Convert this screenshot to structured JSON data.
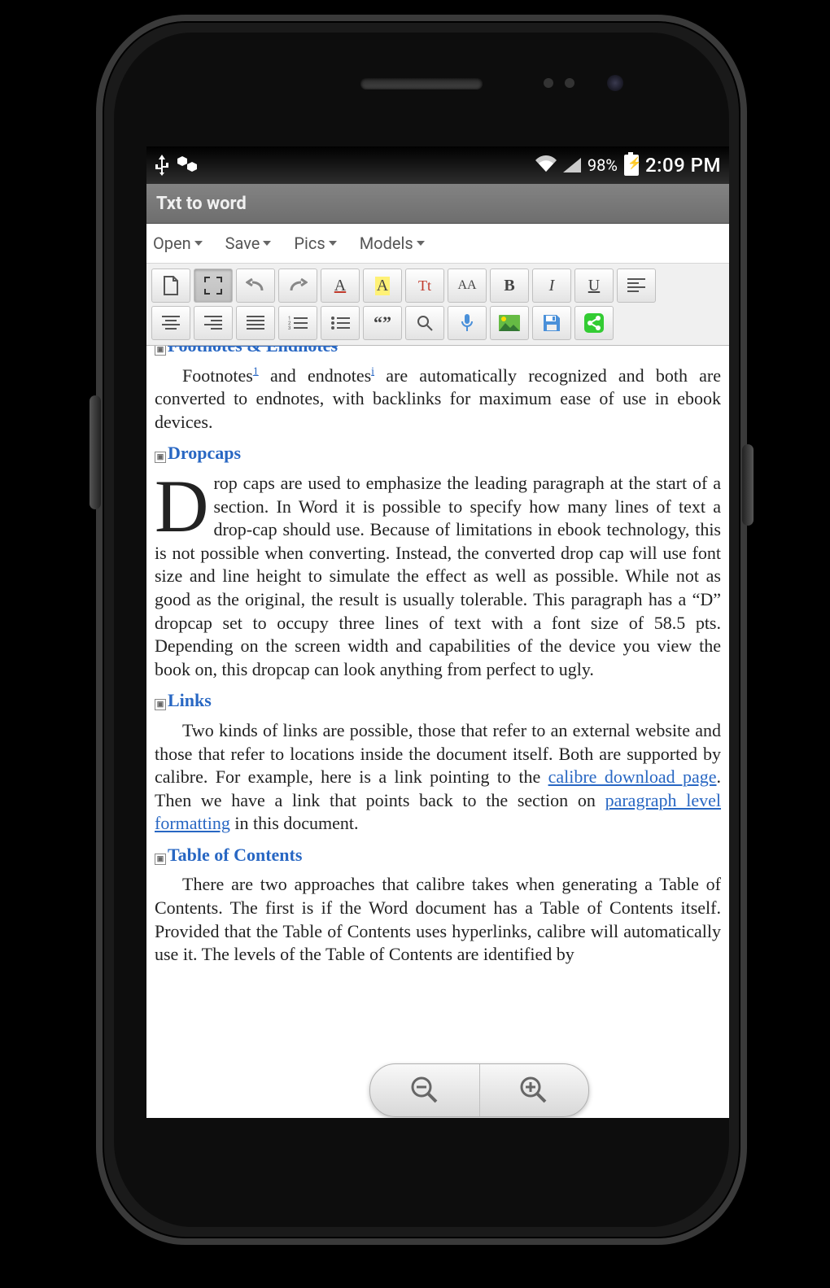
{
  "statusbar": {
    "battery_pct": "98%",
    "clock": "2:09 PM"
  },
  "titlebar": {
    "title": "Txt to word"
  },
  "menubar": {
    "items": [
      "Open",
      "Save",
      "Pics",
      "Models"
    ]
  },
  "doc": {
    "cut_heading": "Footnotes & Endnotes",
    "footnotes_para_before_sup1": "Footnotes",
    "sup1": "1",
    "footnotes_para_mid": " and endnotes",
    "sup2": "i",
    "footnotes_para_after": " are automatically recognized and both are converted to endnotes, with backlinks for maximum ease of use in ebook devices.",
    "h_dropcaps": "Dropcaps",
    "dropcap_letter": "D",
    "dropcaps_para": "rop caps are used to emphasize the leading paragraph at the start of a section. In Word it is possible to specify how many lines of text a drop-cap should use. Because of limitations in ebook technology, this is not possible when converting. Instead, the converted drop cap will use font size and line height to simulate the effect as well as possible. While not as good as the original, the result is usually tolerable. This paragraph has a “D” dropcap set to occupy three lines of text with a font size of 58.5 pts. Depending on the screen width and capabilities of the device you view the book on, this dropcap can look anything from perfect to ugly.",
    "h_links": "Links",
    "links_p1": "Two kinds of links are possible, those that refer to an external website and those that refer to locations inside the document itself. Both are supported by calibre. For example, here is a link pointing to the ",
    "link1": "calibre download page",
    "links_p2": ". Then we have a link that points back to the section on ",
    "link2": "paragraph level formatting",
    "links_p3": " in this document.",
    "h_toc": "Table of Contents",
    "toc_para": "There are two approaches that calibre takes when generating a Table of Contents. The first is if the Word document has a Table of Contents itself. Provided that the Table of Contents uses hyperlinks, calibre will automatically use it. The levels of the Table of Contents are identified by"
  },
  "icons": {
    "Tt": "Tt",
    "AA": "AA",
    "B": "B",
    "I": "I",
    "U": "U",
    "quote": "“”"
  }
}
